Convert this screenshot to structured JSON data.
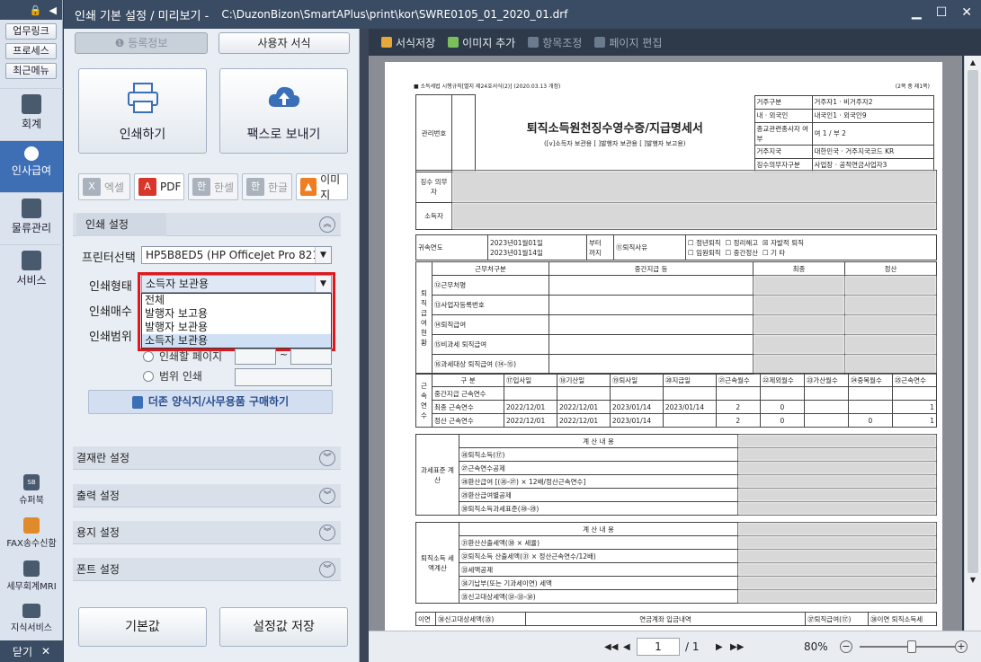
{
  "nav": {
    "quick_links": [
      "업무링크",
      "프로세스",
      "최근메뉴"
    ],
    "sections": [
      {
        "label": "회계",
        "icon": "calculator-icon"
      },
      {
        "label": "인사급여",
        "icon": "person-icon",
        "active": true
      },
      {
        "label": "물류관리",
        "icon": "grid-icon"
      },
      {
        "label": "서비스",
        "icon": "monitor-icon"
      }
    ],
    "bottom_items": [
      {
        "label": "슈퍼북",
        "icon": "sb-icon"
      },
      {
        "label": "FAX송수신함",
        "icon": "fax-icon"
      },
      {
        "label": "세무회계MRI",
        "icon": "mri-icon"
      },
      {
        "label": "지식서비스",
        "icon": "book-icon"
      }
    ],
    "close_label": "닫기",
    "close_glyph": "✕"
  },
  "titlebar": {
    "title": "인쇄 기본 설정 / 미리보기 -",
    "path": "C:\\DuzonBizon\\SmartAPlus\\print\\kor\\SWRE0105_01_2020_01.drf",
    "minimize": "▁",
    "maximize": "☐",
    "close": "✕"
  },
  "panel": {
    "reg_info_label": "등록정보",
    "user_format_label": "사용자 서식",
    "print_label": "인쇄하기",
    "fax_label": "팩스로 보내기",
    "export": {
      "excel": "엑셀",
      "pdf": "PDF",
      "hancell": "한셀",
      "hangul": "한글",
      "image": "이미지"
    },
    "sections": {
      "print_settings": "인쇄 설정",
      "approval": "결재란 설정",
      "output": "출력 설정",
      "paper": "용지 설정",
      "font": "폰트 설정"
    },
    "printer_label": "프린터선택",
    "printer_value": "HP5B8ED5 (HP OfficeJet Pro 8210",
    "print_type_label": "인쇄형태",
    "print_type_value": "소득자 보관용",
    "print_type_options": [
      "전체",
      "발행자 보고용",
      "발행자 보관용",
      "소득자 보관용"
    ],
    "copies_label": "인쇄매수",
    "range_label": "인쇄범위",
    "range_page_label": "인쇄할 페이지",
    "range_tilde": "~",
    "range_print_label": "범위 인쇄",
    "buy_label": "더존 양식지/사무용품 구매하기",
    "default_label": "기본값",
    "save_label": "설정값 저장"
  },
  "preview": {
    "toolbar": [
      "서식저장",
      "이미지 추가",
      "항목조정",
      "페이지 편집"
    ],
    "page_current": "1",
    "page_total": "/ 1",
    "zoom": "80%",
    "zoom_level": 0.55
  },
  "document": {
    "header_note": "■ 소득세법 시행규칙[별지 제24호서식(2)] (2020.03.13 개정)",
    "page_note": "(2쪽 중 제1쪽)",
    "title": "퇴직소득원천징수영수증/지급명세서",
    "subtitle": "([v]소득자 보관용 [ ]발행자 보관용 [ ]발행자 보고용)",
    "mgmt_no_label": "관리번호",
    "right_box": {
      "residency": "거주구분",
      "residency_val": "거주자1 · 비거주자2",
      "nationality": "내 · 외국인",
      "nationality_val": "내국인1 · 외국인9",
      "religion": "종교관련종사자 여부",
      "religion_val": "여 1 / 부 2",
      "country": "거주지국",
      "country_val": "대한민국",
      "country_code_lbl": "거주지국코드",
      "country_code": "KR",
      "agent_type": "징수의무자구분",
      "agent_type_val": "사업장 · 공적연금사업자3"
    },
    "payer_label": "징수 의무자",
    "earner_label": "소득자",
    "period_label": "귀속연도",
    "period_from": "2023년01월01일",
    "period_to": "2023년01월14일",
    "period_from_lbl": "부터",
    "period_to_lbl": "까지",
    "reason_label": "⑪퇴직사유",
    "reasons": [
      "정년퇴직",
      "정리해고",
      "자발적 퇴직",
      "임원퇴직",
      "중간정산",
      "기 타"
    ],
    "reason_checked": "자발적 퇴직",
    "work_section": "근무처구분",
    "mid_settle": "중간지급 등",
    "final": "최종",
    "settle": "정산",
    "rows_income": [
      "⑫근무처명",
      "⑬사업자등록번호",
      "⑭퇴직급여",
      "⑮비과세 퇴직급여",
      "⑯과세대상 퇴직급여 (⑭-⑮)"
    ],
    "side_income": "퇴직 급여 현황",
    "service_cols": [
      "구 분",
      "⑰입사일",
      "⑱기산일",
      "⑲퇴사일",
      "⑳지급일",
      "㉑근속월수",
      "㉒제외월수",
      "㉓가산월수",
      "㉔중복월수",
      "㉕근속연수"
    ],
    "service_rows": [
      {
        "label": "중간지급 근속연수",
        "vals": [
          "",
          "",
          "",
          "",
          "",
          "",
          "",
          "",
          ""
        ]
      },
      {
        "label": "최종 근속연수",
        "vals": [
          "2022/12/01",
          "2022/12/01",
          "2023/01/14",
          "2023/01/14",
          "2",
          "0",
          "",
          "",
          "1"
        ]
      },
      {
        "label": "정산 근속연수",
        "vals": [
          "2022/12/01",
          "2022/12/01",
          "2023/01/14",
          "",
          "2",
          "0",
          "",
          "0",
          "1"
        ]
      }
    ],
    "side_service": "근속 연수",
    "calc_title": "계 산 내 용",
    "calc_rows_a": [
      "㉖퇴직소득(⑰)",
      "㉗근속연수공제",
      "㉘환산급여 [(㉖-㉗) × 12배/정산근속연수]",
      "㉙환산급여별공제",
      "㉚퇴직소득과세표준(㉘-㉙)"
    ],
    "side_calc_a": "과세표준 계산",
    "calc_rows_b": [
      "㉛환산산출세액(㉚ × 세율)",
      "㉜퇴직소득 산출세액(㉛ × 정산근속연수/12배)",
      "㉝세액공제",
      "㉞기납부(또는 기과세이연) 세액",
      "㉟신고대상세액(㉜-㉝-㉞)"
    ],
    "side_calc_b": "퇴직소득 세액계산",
    "bottom_row": [
      "이연",
      "㊱신고대상세액(㉟)",
      "연금계좌 입금내역",
      "㊲퇴직급여(⑰)",
      "㊳이연 퇴직소득세"
    ]
  }
}
